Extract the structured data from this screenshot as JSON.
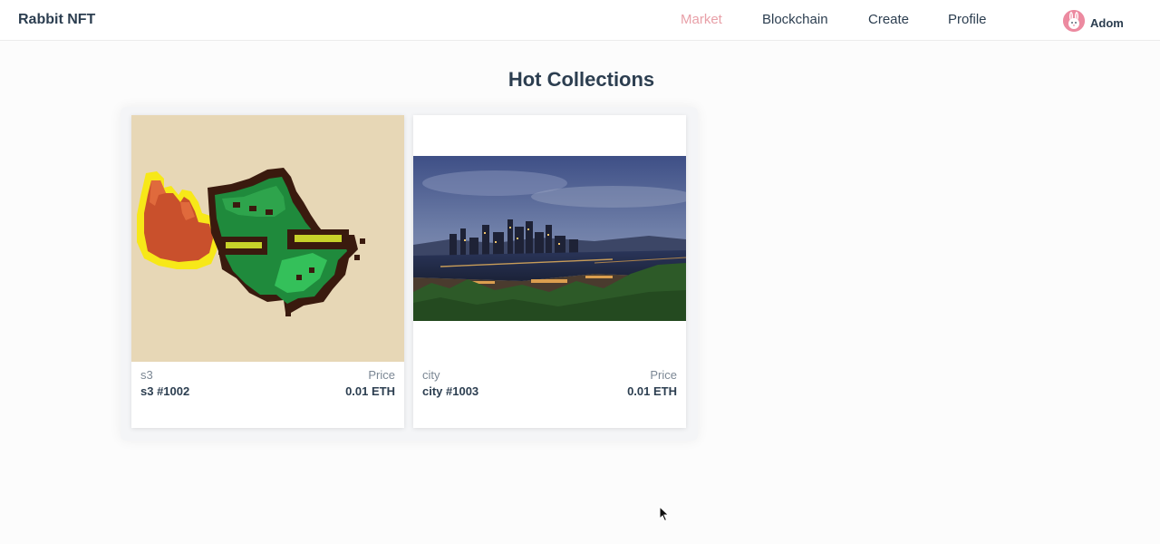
{
  "header": {
    "brand": "Rabbit NFT",
    "nav": [
      {
        "label": "Market",
        "active": true
      },
      {
        "label": "Blockchain",
        "active": false
      },
      {
        "label": "Create",
        "active": false
      },
      {
        "label": "Profile",
        "active": false
      }
    ],
    "user": {
      "name": "Adom",
      "avatar_icon": "rabbit-avatar-icon"
    }
  },
  "main": {
    "title": "Hot Collections",
    "cards": [
      {
        "collection": "s3",
        "price_label": "Price",
        "token": "s3 #1002",
        "price": "0.01 ETH",
        "image": "pixel-art-fire-creature"
      },
      {
        "collection": "city",
        "price_label": "Price",
        "token": "city #1003",
        "price": "0.01 ETH",
        "image": "city-skyline-at-dusk"
      }
    ]
  },
  "colors": {
    "accent_active_nav": "#e8a0a8",
    "text_primary": "#2c3e50",
    "text_muted": "#7b8794",
    "pixel_card_bg": "#e7d7b6"
  }
}
